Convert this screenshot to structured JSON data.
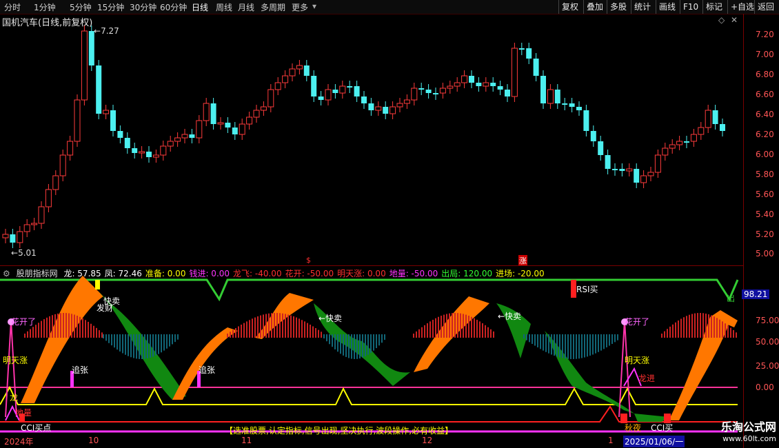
{
  "toolbar": {
    "periods": [
      "分时",
      "1分钟",
      "5分钟",
      "15分钟",
      "30分钟",
      "60分钟",
      "日线",
      "周线",
      "月线",
      "多周期",
      "更多"
    ],
    "active_period": "日线",
    "right_buttons": [
      "复权",
      "叠加",
      "多股",
      "统计",
      "画线",
      "F10",
      "标记",
      "+自选",
      "返回"
    ]
  },
  "main_chart": {
    "title": "国机汽车(日线,前复权)",
    "high_label": "7.27",
    "low_label": "5.01",
    "y_ticks": [
      "7.20",
      "7.00",
      "6.80",
      "6.60",
      "6.40",
      "6.20",
      "6.00",
      "5.80",
      "5.60",
      "5.40",
      "5.20",
      "5.00"
    ],
    "markers": [
      "$",
      "涨"
    ],
    "colors": {
      "up": "#ff3b3b",
      "down": "#4cf0f0",
      "flat": "#ffffff",
      "axis": "#ff5555"
    }
  },
  "indicator": {
    "name": "股朋指标网",
    "values": [
      {
        "label": "龙:",
        "value": "57.85",
        "color": "#ffffff"
      },
      {
        "label": "凤:",
        "value": "72.46",
        "color": "#ffffff"
      },
      {
        "label": "准备:",
        "value": "0.00",
        "color": "#ffff00"
      },
      {
        "label": "钱进:",
        "value": "0.00",
        "color": "#ff33ff"
      },
      {
        "label": "龙飞:",
        "value": "-40.00",
        "color": "#ff3030"
      },
      {
        "label": "花开:",
        "value": "-50.00",
        "color": "#ff3030"
      },
      {
        "label": "明天涨:",
        "value": "0.00",
        "color": "#ff3030"
      },
      {
        "label": "地量:",
        "value": "-50.00",
        "color": "#ff33ff"
      },
      {
        "label": "出局:",
        "value": "120.00",
        "color": "#33ff33"
      },
      {
        "label": "进场:",
        "value": "-20.00",
        "color": "#ffff00"
      }
    ],
    "y_ticks": [
      "98.21",
      "75.00",
      "50.00",
      "25.00",
      "0.00"
    ],
    "annotations": [
      "花开了",
      "明天涨",
      "追张",
      "龙",
      "地量",
      "CCI买点",
      "快卖",
      "发财",
      "←快卖",
      "RSI买",
      "追张",
      "出",
      "花开了",
      "明天涨",
      "龙进",
      "秋夜",
      "CCI买"
    ],
    "banner": "【选准股票,认定指标,信号出现,坚决执行,波段操作,必有收益】",
    "x_labels": [
      "2024年",
      "10",
      "11",
      "12",
      "1",
      "2025/01/06/一"
    ]
  },
  "watermark": {
    "line1": "乐淘公式网",
    "line2": "www.60lt.com"
  }
}
